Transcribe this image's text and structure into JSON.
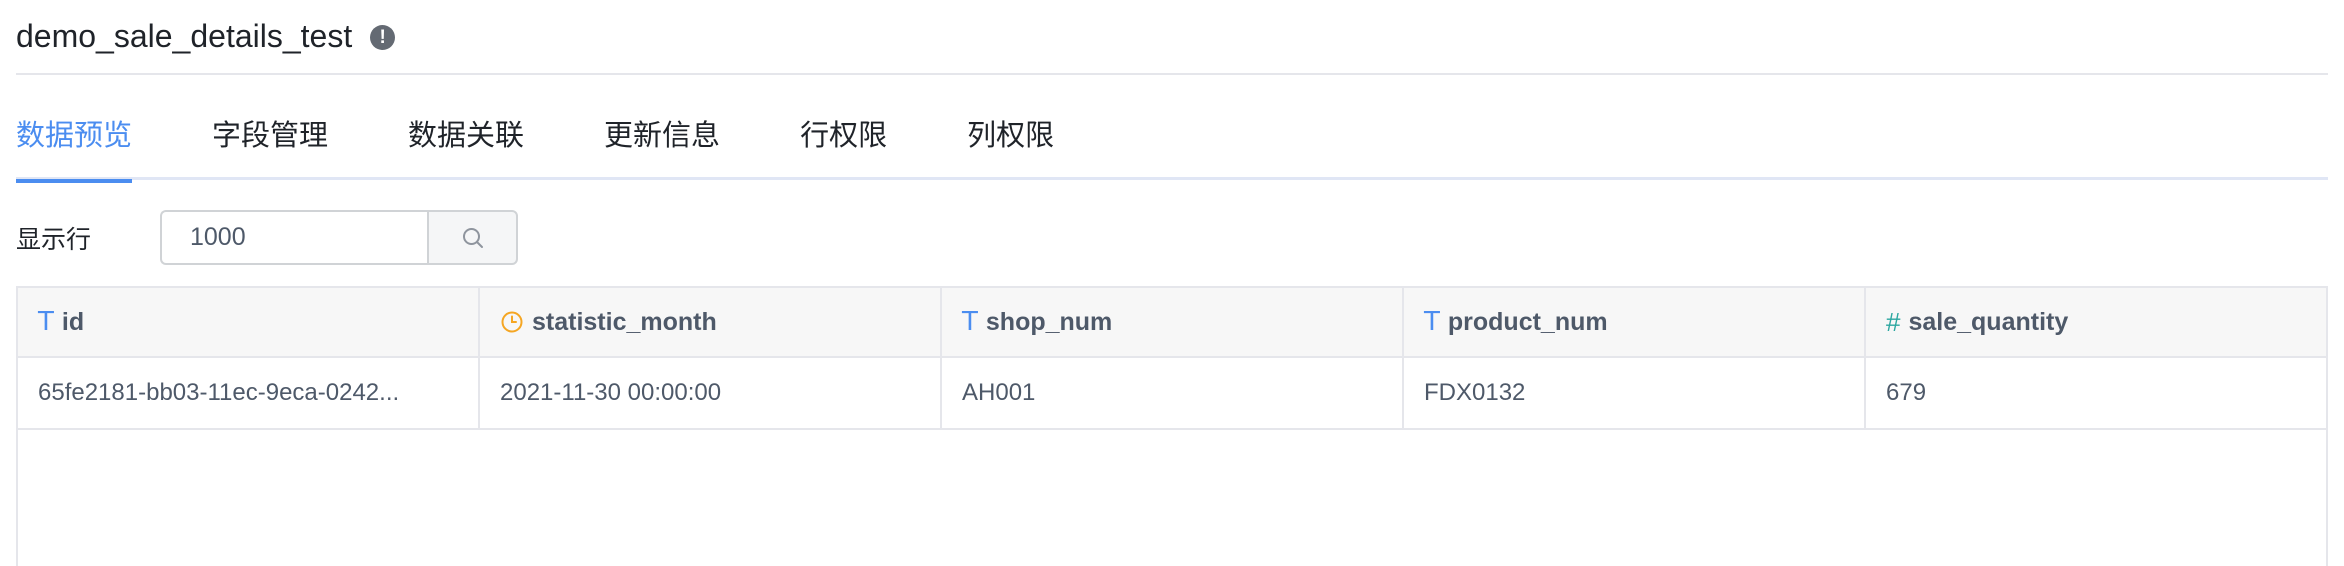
{
  "header": {
    "title": "demo_sale_details_test",
    "info_icon": "info-icon"
  },
  "tabs": [
    {
      "label": "数据预览",
      "active": true
    },
    {
      "label": "字段管理",
      "active": false
    },
    {
      "label": "数据关联",
      "active": false
    },
    {
      "label": "更新信息",
      "active": false
    },
    {
      "label": "行权限",
      "active": false
    },
    {
      "label": "列权限",
      "active": false
    }
  ],
  "rows_control": {
    "label": "显示行",
    "value": "1000",
    "search_icon": "search-icon"
  },
  "table": {
    "columns": [
      {
        "name": "id",
        "type_icon": "text-type-icon",
        "type_glyph": "T"
      },
      {
        "name": "statistic_month",
        "type_icon": "clock-type-icon",
        "type_glyph": ""
      },
      {
        "name": "shop_num",
        "type_icon": "text-type-icon",
        "type_glyph": "T"
      },
      {
        "name": "product_num",
        "type_icon": "text-type-icon",
        "type_glyph": "T"
      },
      {
        "name": "sale_quantity",
        "type_icon": "number-type-icon",
        "type_glyph": "#"
      }
    ],
    "rows": [
      [
        "65fe2181-bb03-11ec-9eca-0242...",
        "2021-11-30 00:00:00",
        "AH001",
        "FDX0132",
        "679"
      ]
    ]
  },
  "colors": {
    "accent": "#4b8df0",
    "clock_icon": "#f5a623",
    "number_icon": "#2ca7a0",
    "border": "#e5e6eb"
  }
}
